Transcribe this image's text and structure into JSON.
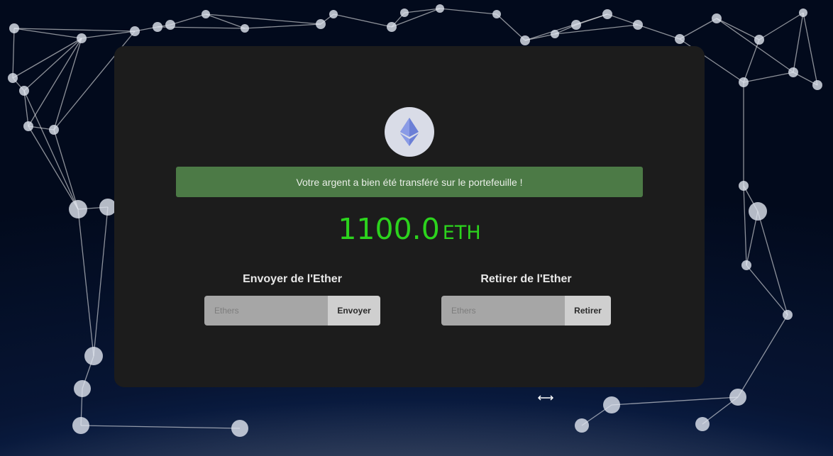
{
  "alert": {
    "message": "Votre argent a bien été transféré sur le portefeuille !"
  },
  "balance": {
    "amount": "1100.0",
    "unit": "ETH"
  },
  "send": {
    "title": "Envoyer de l'Ether",
    "placeholder": "Ethers",
    "button": "Envoyer"
  },
  "withdraw": {
    "title": "Retirer de l'Ether",
    "placeholder": "Ethers",
    "button": "Retirer"
  },
  "icons": {
    "logo": "ethereum-icon"
  },
  "colors": {
    "balance": "#2cd31d",
    "alert": "#4c7a46",
    "card": "#1c1c1c",
    "logo_bg": "#d9dce7",
    "logo_fg": "#6b7fd6"
  }
}
